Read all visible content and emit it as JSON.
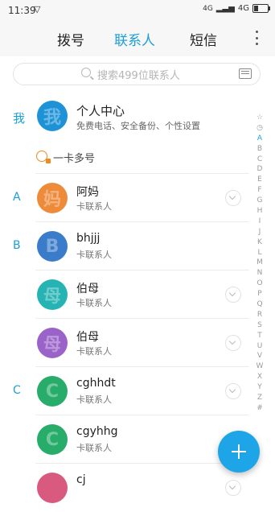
{
  "status_bar": {
    "time": "11:39",
    "signal_text": "4G",
    "network": "4G"
  },
  "tabs": [
    {
      "label": "拨号",
      "active": false
    },
    {
      "label": "联系人",
      "active": true
    },
    {
      "label": "短信",
      "active": false
    }
  ],
  "search": {
    "placeholder": "搜索499位联系人"
  },
  "me": {
    "section_letter": "我",
    "avatar_char": "我",
    "name": "个人中心",
    "subtitle": "免费电话、安全备份、个性设置"
  },
  "dual_sim": {
    "label": "一卡多号",
    "icon": "dual-sim-icon"
  },
  "contacts": [
    {
      "section": "A",
      "name": "阿妈",
      "sub": "卡联系人",
      "avatar_char": "妈",
      "color": "#ee8b3a",
      "chevron": true
    },
    {
      "section": "B",
      "name": "bhjjj",
      "sub": "卡联系人",
      "avatar_char": "B",
      "color": "#3a7cc9",
      "chevron": false
    },
    {
      "section": "",
      "name": "伯母",
      "sub": "卡联系人",
      "avatar_char": "母",
      "color": "#26b3b3",
      "chevron": true
    },
    {
      "section": "",
      "name": "伯母",
      "sub": "卡联系人",
      "avatar_char": "母",
      "color": "#9a63c9",
      "chevron": true
    },
    {
      "section": "C",
      "name": "cghhdt",
      "sub": "卡联系人",
      "avatar_char": "C",
      "color": "#27ac6a",
      "chevron": true
    },
    {
      "section": "",
      "name": "cgyhhg",
      "sub": "卡联系人",
      "avatar_char": "C",
      "color": "#27ac6a",
      "chevron": false
    },
    {
      "section": "",
      "name": "cj",
      "sub": "",
      "avatar_char": "",
      "color": "#d85a7f",
      "chevron": true
    }
  ],
  "index_bar": [
    "☆",
    "◷",
    "A",
    "B",
    "C",
    "D",
    "E",
    "F",
    "G",
    "H",
    "I",
    "J",
    "K",
    "L",
    "M",
    "N",
    "O",
    "P",
    "Q",
    "R",
    "S",
    "T",
    "U",
    "V",
    "W",
    "X",
    "Y",
    "Z",
    "#"
  ],
  "index_active": "A",
  "colors": {
    "accent": "#1a9fd8",
    "fab": "#1ea5e8"
  }
}
